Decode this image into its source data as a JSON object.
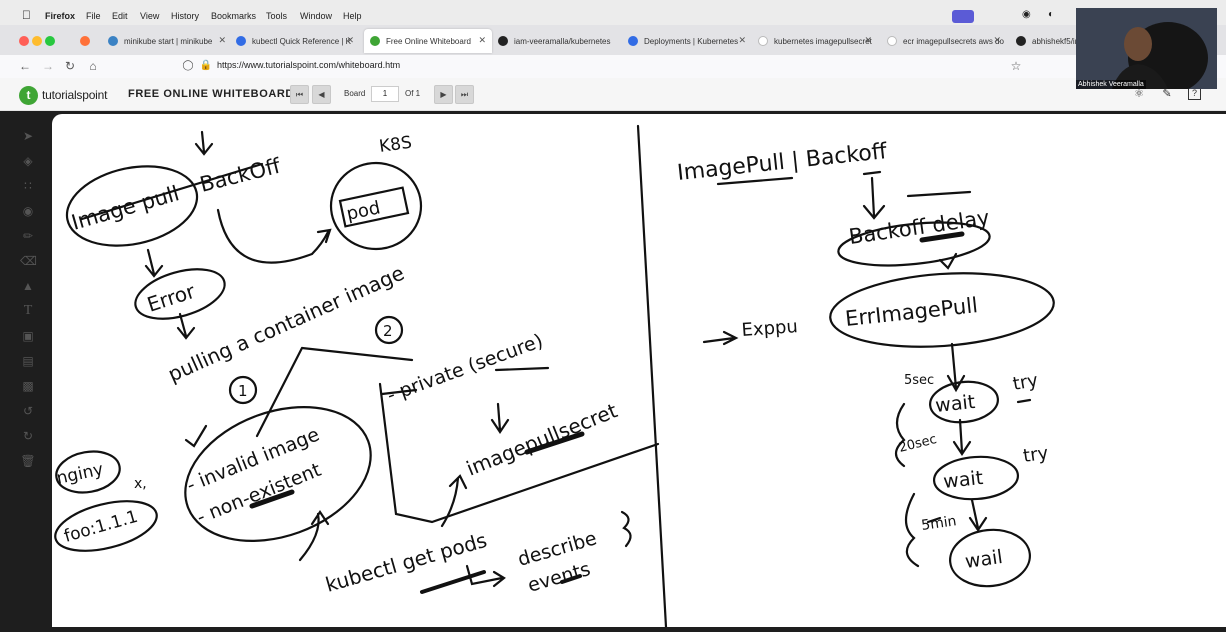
{
  "menubar": {
    "app": "Firefox",
    "items": [
      "File",
      "Edit",
      "View",
      "History",
      "Bookmarks",
      "Tools",
      "Window",
      "Help"
    ]
  },
  "tabs": [
    {
      "label": "",
      "icon": "firefox-icon"
    },
    {
      "label": "minikube start | minikube",
      "icon": "minikube-icon"
    },
    {
      "label": "kubectl Quick Reference | K",
      "icon": "kubernetes-icon"
    },
    {
      "label": "Free Online Whiteboard",
      "icon": "tutorialspoint-icon",
      "active": true
    },
    {
      "label": "iam-veeramalla/kubernetes",
      "icon": "github-icon"
    },
    {
      "label": "Deployments | Kubernetes",
      "icon": "kubernetes-icon"
    },
    {
      "label": "kubernetes imagepullsecret",
      "icon": "google-icon"
    },
    {
      "label": "ecr imagepullsecrets aws do",
      "icon": "google-icon"
    },
    {
      "label": "abhishekf5/im",
      "icon": "github-icon"
    }
  ],
  "navbar": {
    "url": "https://www.tutorialspoint.com/whiteboard.htm"
  },
  "page": {
    "logo_text": "tutorialspoint",
    "title": "FREE ONLINE WHITEBOARD",
    "board_label": "Board",
    "board_value": "1",
    "of_label": "Of 1"
  },
  "webcam": {
    "name": "Abhishek Veeramalla"
  },
  "whiteboard": {
    "left": {
      "k8s": "K8S",
      "pod": "pod",
      "image_pull": "Image pull",
      "backoff": "BackOff",
      "error": "Error",
      "pulling": "pulling a container image",
      "num2": "2",
      "num1": "1",
      "private": "- private (secure)",
      "invalid1": "- invalid image",
      "invalid2": "- non-existent",
      "imagepullsecret": "imagepullsecret",
      "nginy": "nginy",
      "x1": "x,",
      "foo": "foo:1.1.1",
      "kubectl": "kubectl get pods",
      "describe": "describe",
      "events": "events"
    },
    "right": {
      "heading": "ImagePull | Backoff",
      "backoff_delay": "Backoff delay",
      "errimagepull": "ErrImagePull",
      "exppu": "Exppu",
      "s5": "5sec",
      "wait1": "wait",
      "try1": "try",
      "s20": "20sec",
      "wait2": "wait",
      "try2": "try",
      "m5": "5min",
      "wait3": "wail"
    }
  }
}
